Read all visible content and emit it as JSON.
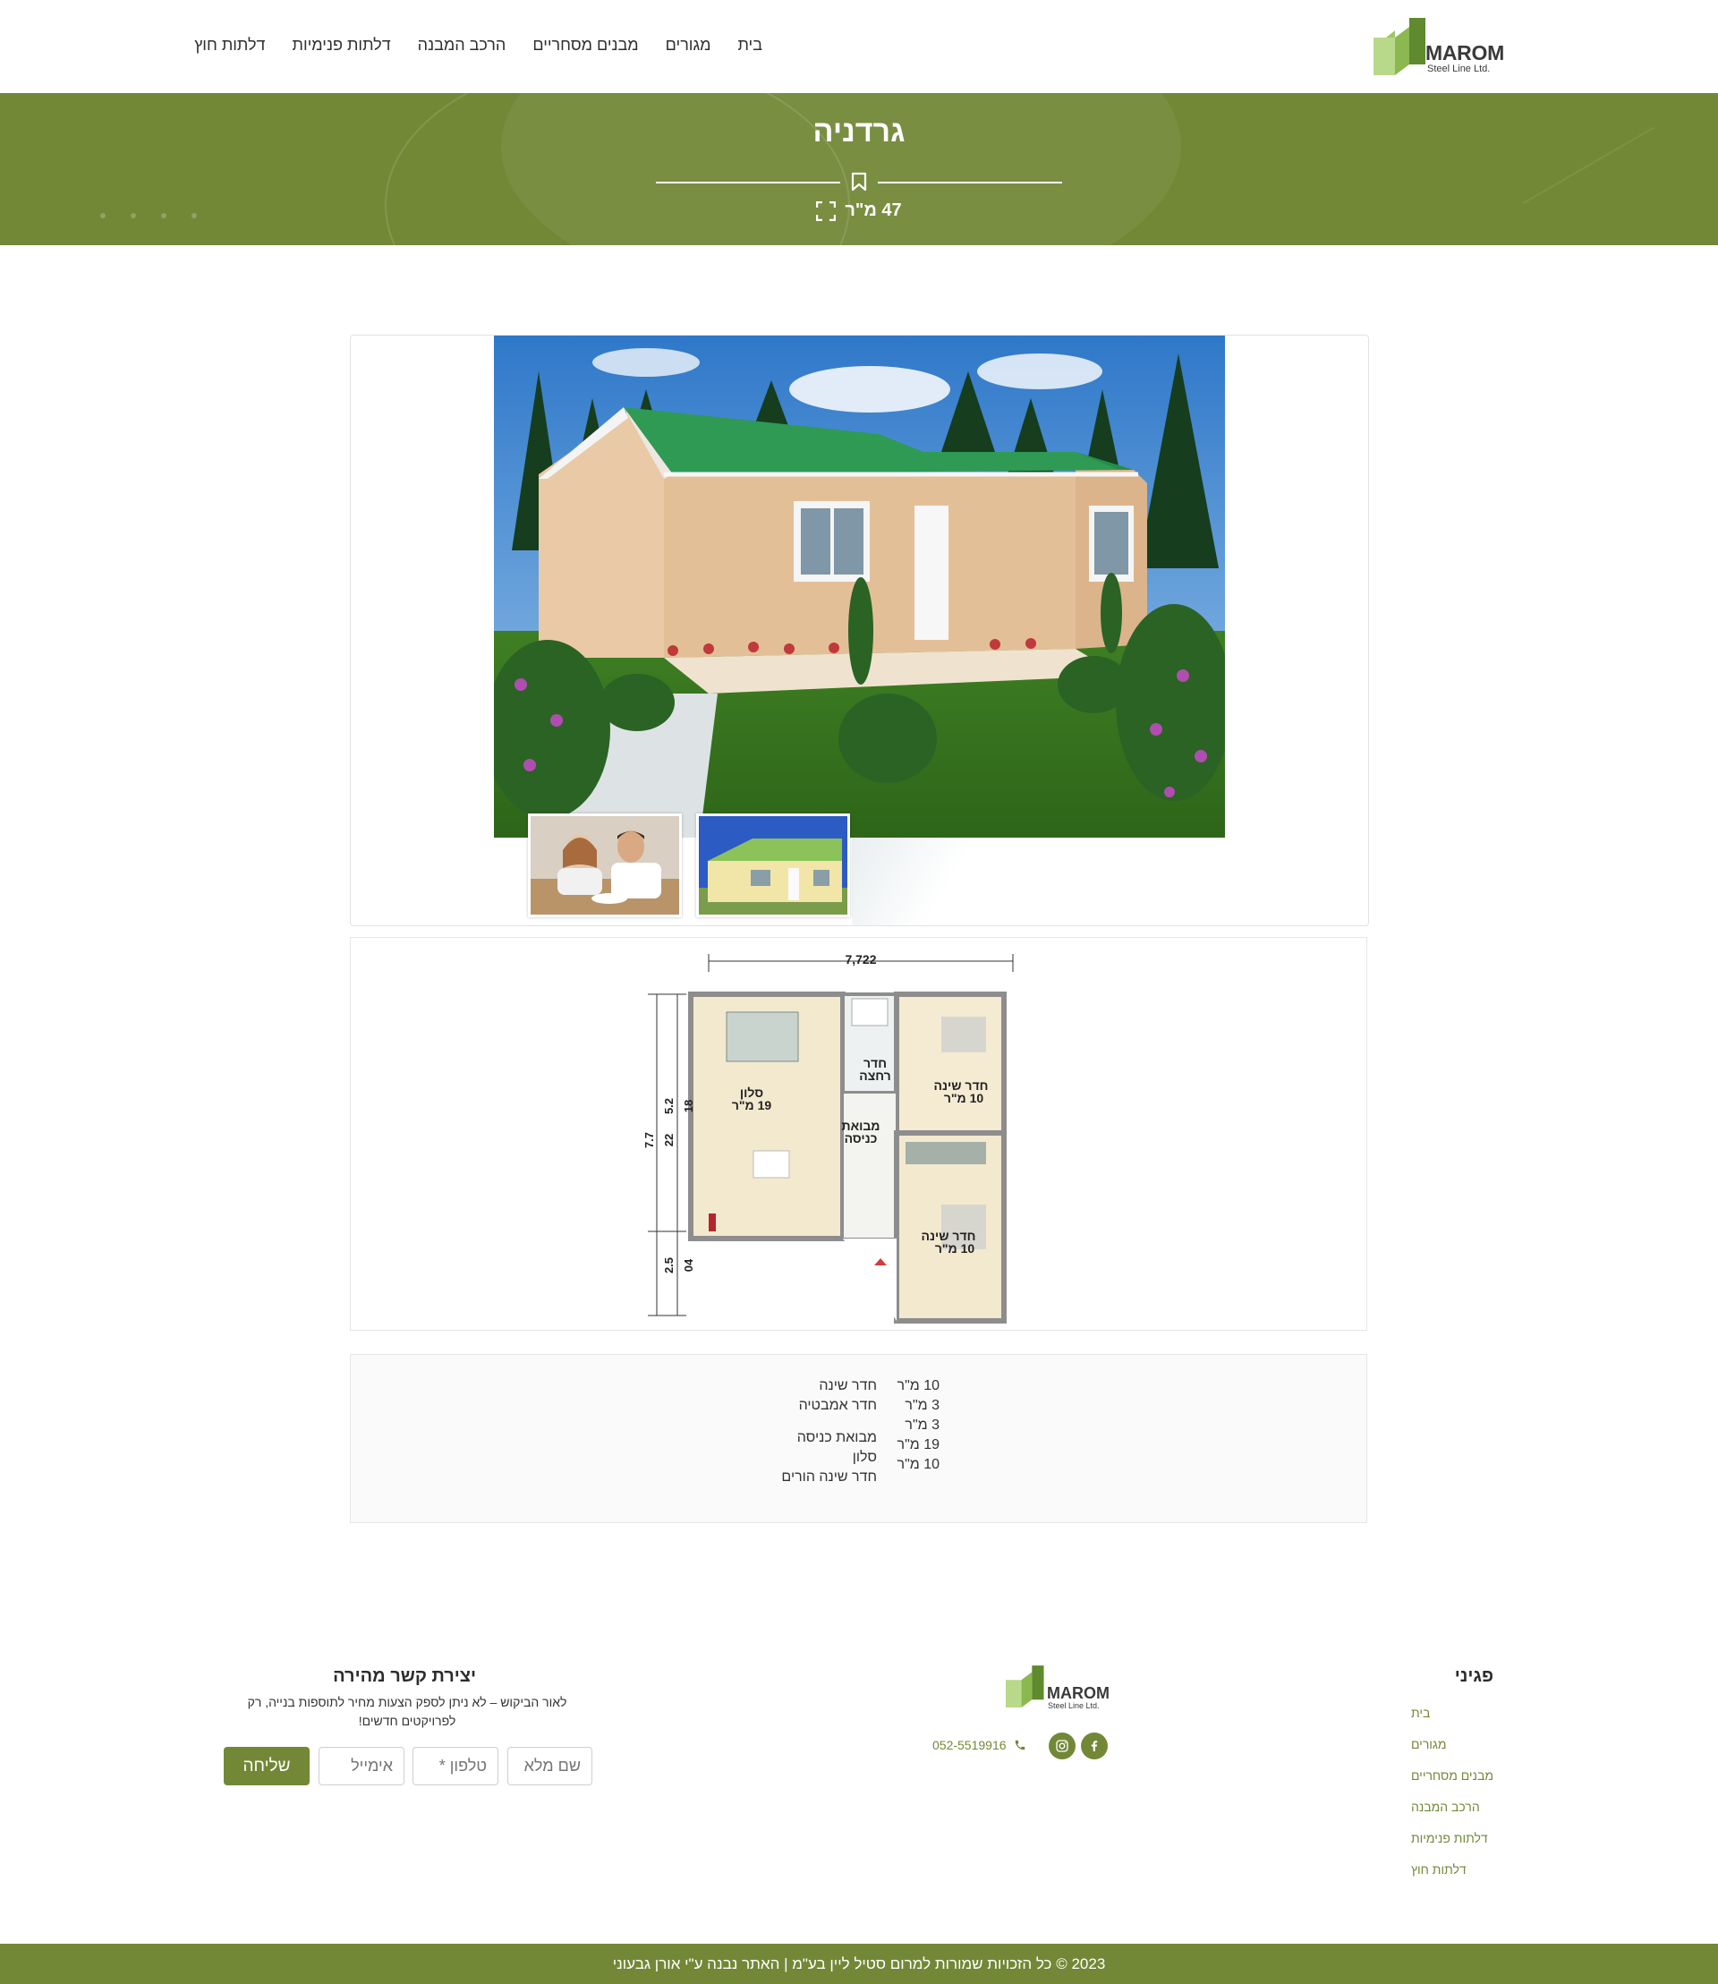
{
  "brand": {
    "name": "MAROM",
    "sub": "Steel Line Ltd.",
    "colors": {
      "primary": "#728837",
      "logo_dark": "#5f8a2e",
      "logo_light": "#b8d88a"
    }
  },
  "nav": {
    "items": [
      {
        "label": "בית"
      },
      {
        "label": "מגורים"
      },
      {
        "label": "מבנים מסחריים"
      },
      {
        "label": "הרכב המבנה"
      },
      {
        "label": "דלתות פנימיות"
      },
      {
        "label": "דלתות חוץ"
      }
    ]
  },
  "banner": {
    "title": "גרדניה",
    "area_label": "47 מ\"ר",
    "icons": [
      "bookmark-icon",
      "expand-icon"
    ]
  },
  "gallery": {
    "main_image": "house-render",
    "thumbnails": [
      "couple-dining",
      "house-exterior-yellow"
    ]
  },
  "floorplan": {
    "width_dim": "7,722",
    "height_dims": [
      "7.7",
      "22",
      "5.2",
      "18",
      "2.5",
      "04"
    ],
    "rooms": [
      {
        "line1": "חדר",
        "line2": "רחצה"
      },
      {
        "line1": "חדר שינה",
        "line2": "10 מ\"ר"
      },
      {
        "line1": "סלון",
        "line2": "19 מ\"ר"
      },
      {
        "line1": "מבואת",
        "line2": "כניסה"
      },
      {
        "line1": "חדר שינה",
        "line2": "10 מ\"ר"
      }
    ]
  },
  "rooms_table": {
    "names": [
      "חדר שינה",
      "חדר אמבטיה",
      "מבואת כניסה",
      "סלון",
      "חדר שינה הורים"
    ],
    "sizes": [
      "10 מ\"ר",
      "3 מ\"ר",
      "3 מ\"ר",
      "19 מ\"ר",
      "10 מ\"ר"
    ]
  },
  "footer": {
    "pages_title": "פגיני",
    "pages": [
      {
        "label": "בית"
      },
      {
        "label": "מגורים"
      },
      {
        "label": "מבנים מסחריים"
      },
      {
        "label": "הרכב המבנה"
      },
      {
        "label": "דלתות פנימיות"
      },
      {
        "label": "דלתות חוץ"
      }
    ],
    "phone": "052-5519916",
    "social": [
      "facebook-icon",
      "instagram-icon"
    ],
    "contact_title": "יצירת קשר מהירה",
    "contact_desc": "לאור הביקוש – לא ניתן לספק הצעות מחיר לתוספות בנייה, רק לפרויקטים חדשים!",
    "form": {
      "name_placeholder": "שם מלא",
      "phone_placeholder": "טלפון *",
      "email_placeholder": "אימייל",
      "submit_label": "שליחה"
    },
    "copyright": "2023 © כל הזכויות שמורות למרום סטיל ליין בע\"מ | האתר נבנה ע\"י אורן גבעוני"
  }
}
